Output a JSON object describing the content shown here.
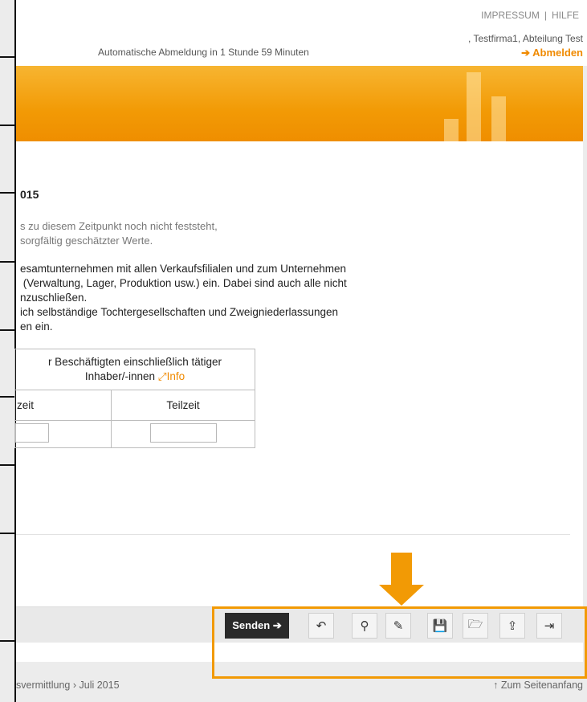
{
  "header": {
    "links": [
      "IMPRESSUM",
      "HILFE"
    ],
    "link_separator": "|",
    "user": ", Testfirma1, Abteilung Test",
    "logout": "➔ Abmelden",
    "auto_logout": "Automatische Abmeldung in 1 Stunde 59 Minuten"
  },
  "main": {
    "heading": "015",
    "note_lines": [
      "s zu diesem Zeitpunkt noch nicht feststeht,",
      "sorgfältig geschätzter Werte."
    ],
    "instruction_lines": [
      "esamtunternehmen mit allen Verkaufsfilialen und zum Unternehmen",
      " (Verwaltung, Lager, Produktion usw.) ein. Dabei sind auch alle nicht",
      "nzuschließen.",
      "ich selbständige Tochtergesellschaften und Zweigniederlassungen",
      "en ein."
    ],
    "table": {
      "header_line1": "r Beschäftigten einschließlich tätiger",
      "header_line2": "Inhaber/-innen",
      "info_link": "Info",
      "col_fulltime": "zeit",
      "col_parttime": "Teilzeit",
      "fulltime_value": "",
      "parttime_value": ""
    }
  },
  "toolbar": {
    "send_label": "Senden ➔",
    "buttons": [
      {
        "name": "undo-icon",
        "glyph": "↶"
      },
      {
        "name": "search-icon",
        "glyph": "⚲"
      },
      {
        "name": "document-edit-icon",
        "glyph": "✎"
      },
      {
        "name": "save-icon",
        "glyph": "💾"
      },
      {
        "name": "folder-open-icon",
        "glyph": "🗁"
      },
      {
        "name": "export-icon",
        "glyph": "⇪"
      },
      {
        "name": "exit-icon",
        "glyph": "⇥"
      }
    ]
  },
  "footer": {
    "breadcrumb": "svermittlung › Juli 2015",
    "to_top": "↑ Zum Seitenanfang"
  },
  "colors": {
    "accent": "#f29a05",
    "send_bg": "#2a2a2a"
  }
}
